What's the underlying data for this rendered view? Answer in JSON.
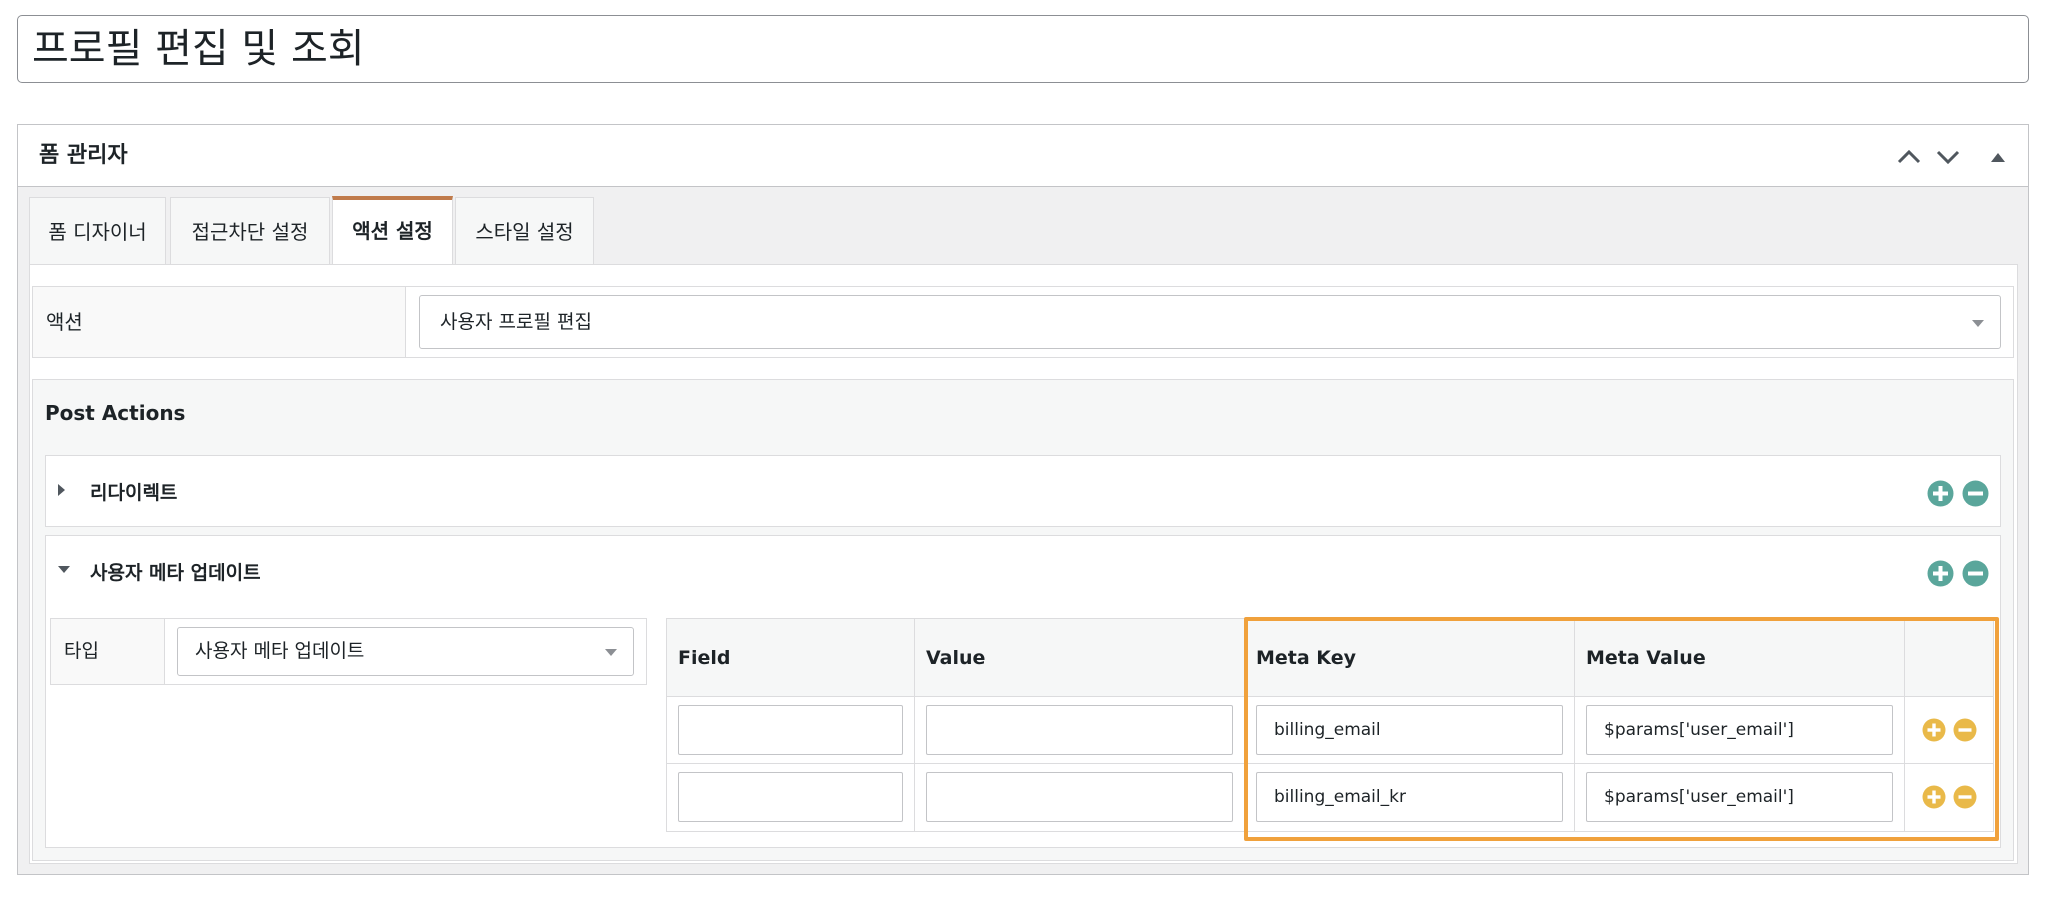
{
  "page": {
    "title": "프로필 편집 및 조회"
  },
  "panel": {
    "title": "폼 관리자",
    "controls": [
      "chevron-up-icon",
      "chevron-down-icon",
      "triangle-up-icon"
    ]
  },
  "tabs": [
    {
      "label": "폼 디자이너",
      "active": false
    },
    {
      "label": "접근차단 설정",
      "active": false
    },
    {
      "label": "액션 설정",
      "active": true
    },
    {
      "label": "스타일 설정",
      "active": false
    }
  ],
  "action_row": {
    "label": "액션",
    "value": "사용자 프로필 편집"
  },
  "post_actions": {
    "title": "Post Actions",
    "items": [
      {
        "title": "리다이렉트",
        "expanded": false
      },
      {
        "title": "사용자 메타 업데이트",
        "expanded": true,
        "type": {
          "label": "타입",
          "value": "사용자 메타 업데이트"
        },
        "table": {
          "headers": [
            "Field",
            "Value",
            "Meta Key",
            "Meta Value"
          ],
          "rows": [
            {
              "field": "",
              "value": "",
              "meta_key": "billing_email",
              "meta_value": "$params['user_email']"
            },
            {
              "field": "",
              "value": "",
              "meta_key": "billing_email_kr",
              "meta_value": "$params['user_email']"
            }
          ]
        }
      }
    ]
  },
  "colors": {
    "accent_tab": "#c07b4b",
    "teal_button": "#5aa69b",
    "yellow_button": "#e9b949",
    "highlight": "#f0a13c"
  }
}
